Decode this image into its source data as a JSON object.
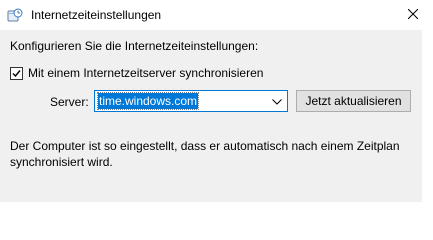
{
  "window": {
    "title": "Internetzeiteinstellungen",
    "icon": "clock-globe-icon",
    "close_icon": "close-icon"
  },
  "content": {
    "intro": "Konfigurieren Sie die Internetzeiteinstellungen:",
    "sync_checkbox": {
      "label": "Mit einem Internetzeitserver synchronisieren",
      "checked": true
    },
    "server": {
      "label": "Server:",
      "value": "time.windows.com",
      "selected": true
    },
    "update_button": "Jetzt aktualisieren",
    "info_text": "Der Computer ist so eingestellt, dass er automatisch nach einem Zeitplan synchronisiert wird."
  },
  "colors": {
    "accent": "#0078d7",
    "background": "#f0f0f0",
    "button": "#e1e1e1"
  }
}
